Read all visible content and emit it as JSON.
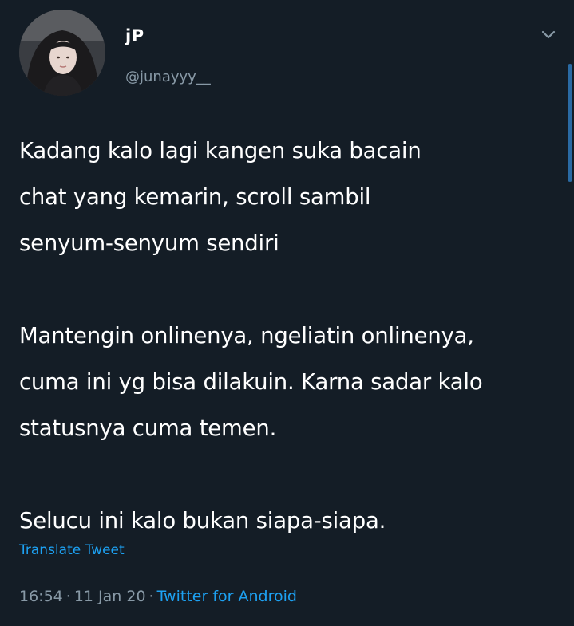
{
  "tweet": {
    "author": {
      "display_name": "jP",
      "handle": "@junayyy__",
      "avatar": "profile-photo"
    },
    "more_icon": "chevron-down-icon",
    "paragraphs": [
      "Kadang kalo lagi kangen suka bacain\nchat yang kemarin, scroll sambil\nsenyum-senyum sendiri",
      "Mantengin onlinenya, ngeliatin onlinenya,\ncuma ini yg bisa dilakuin. Karna sadar kalo\nstatusnya cuma temen.",
      "Selucu ini kalo bukan siapa-siapa."
    ],
    "translate_label": "Translate Tweet",
    "time": "16:54",
    "separator": "·",
    "date": "11 Jan 20",
    "source": "Twitter for Android"
  },
  "colors": {
    "background": "#141d26",
    "text": "#ffffff",
    "secondary_text": "#8899a6",
    "accent": "#1da1f2"
  }
}
